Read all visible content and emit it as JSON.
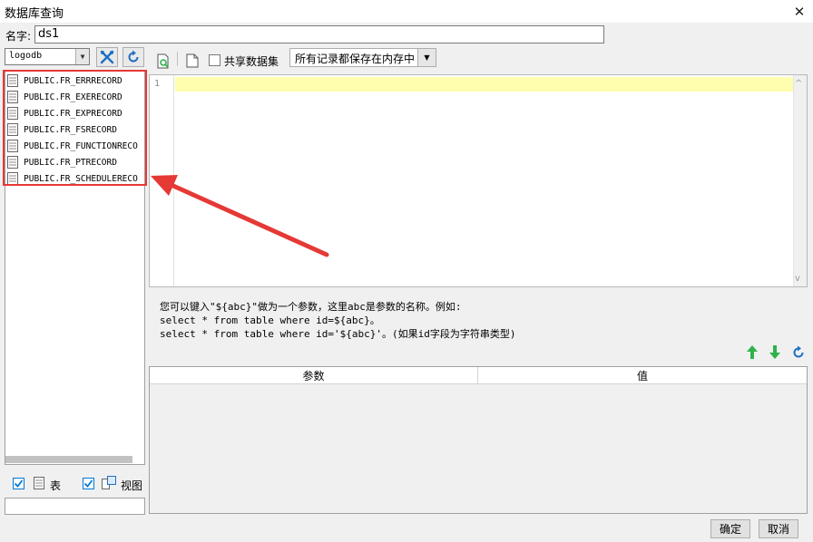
{
  "window": {
    "title": "数据库查询",
    "close_glyph": "✕"
  },
  "name_field": {
    "label": "名字:",
    "value": "ds1"
  },
  "connection": {
    "selected": "logodb"
  },
  "toolbar": {
    "shared_dataset_label": "共享数据集",
    "memory_option": "所有记录都保存在内存中"
  },
  "tables": [
    "PUBLIC.FR_ERRRECORD",
    "PUBLIC.FR_EXERECORD",
    "PUBLIC.FR_EXPRECORD",
    "PUBLIC.FR_FSRECORD",
    "PUBLIC.FR_FUNCTIONRECO",
    "PUBLIC.FR_PTRECORD",
    "PUBLIC.FR_SCHEDULERECO"
  ],
  "filters": {
    "table_label": "表",
    "view_label": "视图"
  },
  "editor": {
    "line_number": "1"
  },
  "hint": {
    "line1": "您可以键入\"${abc}\"做为一个参数，这里abc是参数的名称。例如:",
    "line2": "select * from table where id=${abc}。",
    "line3": "select * from table where id='${abc}'。(如果id字段为字符串类型)"
  },
  "params": {
    "col_param": "参数",
    "col_value": "值"
  },
  "buttons": {
    "ok": "确定",
    "cancel": "取消"
  },
  "colors": {
    "highlight_box": "#e53935",
    "current_line": "#fffdae",
    "green_arrow": "#2db34a",
    "blue_icon": "#1e6fc4"
  }
}
